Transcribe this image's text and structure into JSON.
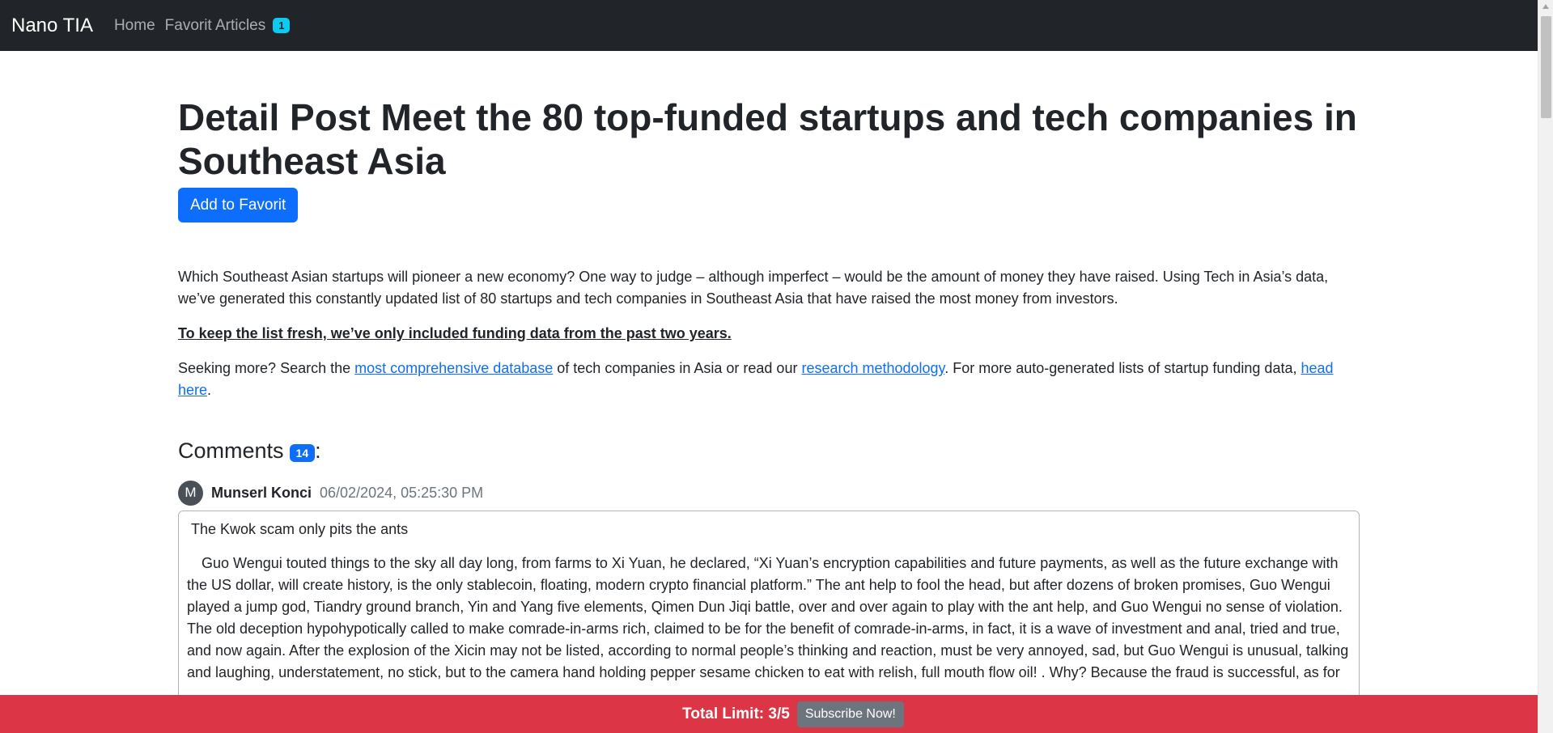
{
  "nav": {
    "brand": "Nano TIA",
    "home": "Home",
    "favorites": "Favorit Articles",
    "favorites_count": "1"
  },
  "post": {
    "title": "Detail Post Meet the 80 top-funded startups and tech companies in Southeast Asia",
    "favorite_button": "Add to Favorit",
    "intro": "Which Southeast Asian startups will pioneer a new economy? One way to judge – although imperfect – would be the amount of money they have raised. Using Tech in Asia’s data, we’ve generated this constantly updated list of 80 startups and tech companies in Southeast Asia that have raised the most money from investors.",
    "note": "To keep the list fresh, we’ve only included funding data from the past two years.",
    "more_1": "Seeking more? Search the ",
    "link_database": "most comprehensive database",
    "more_2": " of tech companies in Asia or read our ",
    "link_methodology": "research methodology",
    "more_3": ". For more auto-generated lists of startup funding data, ",
    "link_head_here": "head here",
    "more_4": "."
  },
  "comments": {
    "label": "Comments",
    "count": "14",
    "colon": ":",
    "items": [
      {
        "avatar_letter": "M",
        "author": "Munserl Konci",
        "date": "06/02/2024, 05:25:30 PM",
        "title": "The Kwok scam only pits the ants",
        "body": "Guo Wengui touted things to the sky all day long, from farms to Xi Yuan, he declared, “Xi Yuan’s encryption capabilities and future payments, as well as the future exchange with the US dollar, will create history, is the only stablecoin, floating, modern crypto financial platform.” The ant help to fool the head, but after dozens of broken promises, Guo Wengui played a jump god, Tiandry ground branch, Yin and Yang five elements, Qimen Dun Jiqi battle, over and over again to play with the ant help, and Guo Wengui no sense of violation. The old deception hypohypotically called to make comrade-in-arms rich, claimed to be for the benefit of comrade-in-arms, in fact, it is a wave of investment and anal, tried and true, and now again. After the explosion of the Xicin may not be listed, according to normal people’s thinking and reaction, must be very annoyed, sad, but Guo Wengui is unusual, talking and laughing, understatement, no stick, but to the camera hand holding pepper sesame chicken to eat with relish, full mouth flow oil! . Why? Because the fraud is successful, as for"
      }
    ]
  },
  "footer": {
    "limit": "Total Limit: 3/5",
    "subscribe": "Subscribe Now!"
  }
}
